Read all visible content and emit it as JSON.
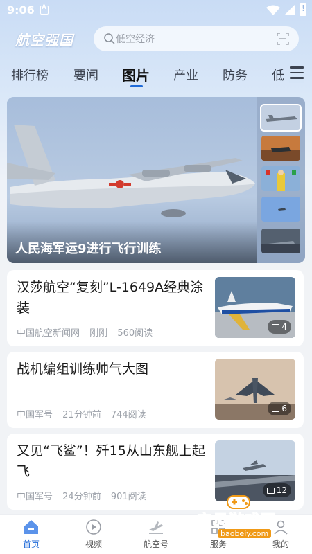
{
  "status_bar": {
    "time": "9:06"
  },
  "header": {
    "logo_text": "航空强国",
    "search_placeholder": "低空经济"
  },
  "tabs": [
    {
      "label": "排行榜"
    },
    {
      "label": "要闻"
    },
    {
      "label": "图片",
      "active": true
    },
    {
      "label": "产业"
    },
    {
      "label": "防务"
    },
    {
      "label": "低"
    }
  ],
  "hero": {
    "caption": "人民海军运9进行飞行训练",
    "thumbnail_count": 5
  },
  "articles": [
    {
      "title": "汉莎航空“复刻”L-1649A经典涂装",
      "source": "中国航空新闻网",
      "time": "刚刚",
      "reads": "560阅读",
      "image_count": "4"
    },
    {
      "title": "战机编组训练帅气大图",
      "source": "中国军号",
      "time": "21分钟前",
      "reads": "744阅读",
      "image_count": "6"
    },
    {
      "title": "又见“飞鲨”！歼15从山东舰上起飞",
      "source": "中国军号",
      "time": "24分钟前",
      "reads": "901阅读",
      "image_count": "12"
    }
  ],
  "bottom_nav": [
    {
      "label": "首页",
      "icon": "home-icon",
      "active": true
    },
    {
      "label": "视频",
      "icon": "play-icon"
    },
    {
      "label": "航空号",
      "icon": "plane-icon"
    },
    {
      "label": "服务",
      "icon": "grid-icon"
    },
    {
      "label": "我的",
      "icon": "user-icon"
    }
  ],
  "watermark": {
    "text": "宝贝游戏网",
    "url": "baobeiy.com"
  },
  "colors": {
    "accent": "#1f6ad8",
    "watermark": "#f4a21a"
  }
}
